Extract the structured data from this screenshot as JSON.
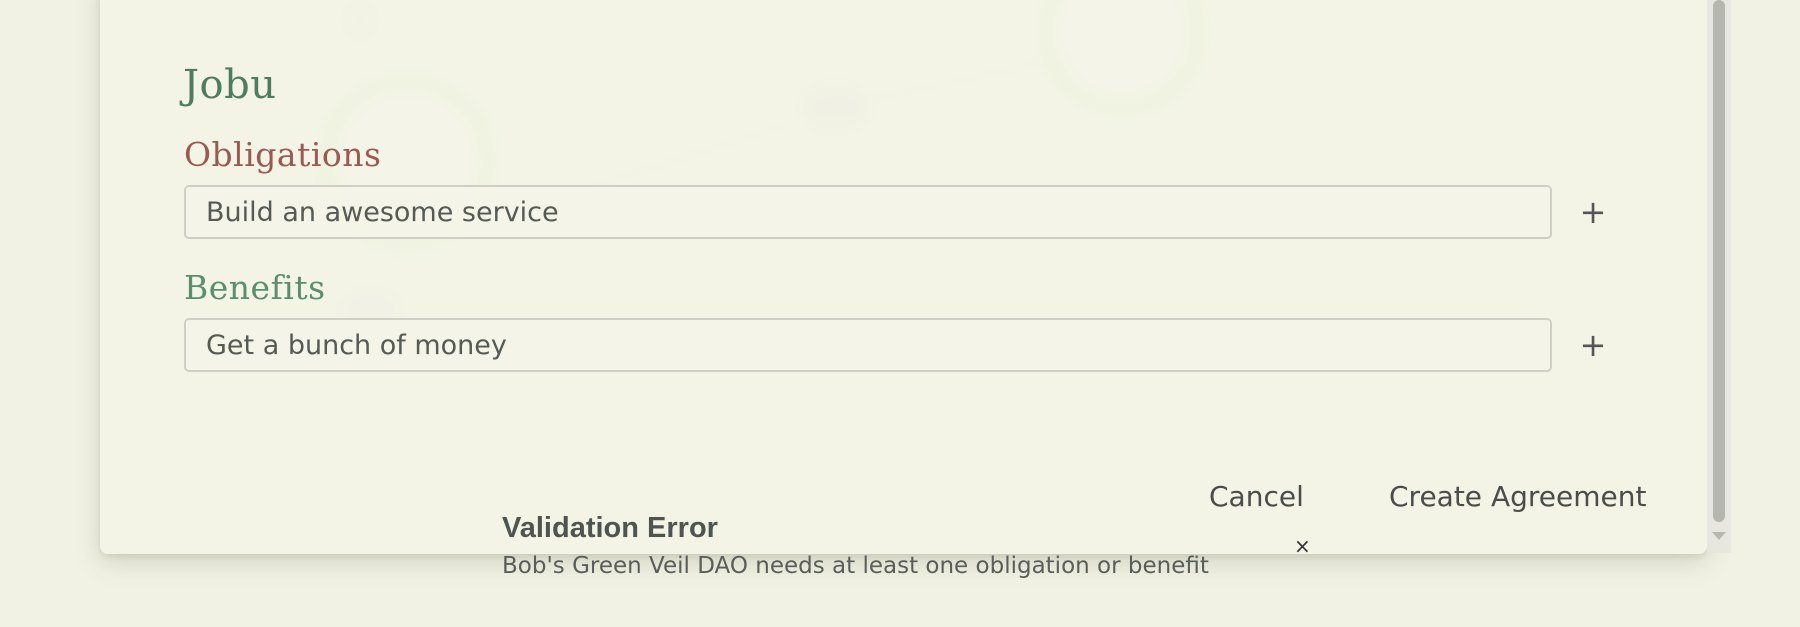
{
  "modal": {
    "title": "Jobu",
    "obligations": {
      "label": "Obligations",
      "value": "Build an awesome service",
      "add_label": "+"
    },
    "benefits": {
      "label": "Benefits",
      "value": "Get a bunch of money",
      "add_label": "+"
    },
    "actions": {
      "cancel_label": "Cancel",
      "create_label": "Create Agreement"
    }
  },
  "toast": {
    "title": "Validation Error",
    "message": "Bob's Green Veil DAO needs at least one obligation or benefit",
    "close_label": "×"
  },
  "colors": {
    "background": "#f1f2e3",
    "title": "#4f7c5e",
    "obligations_label": "#9a5a52",
    "benefits_label": "#5a8f6a"
  }
}
